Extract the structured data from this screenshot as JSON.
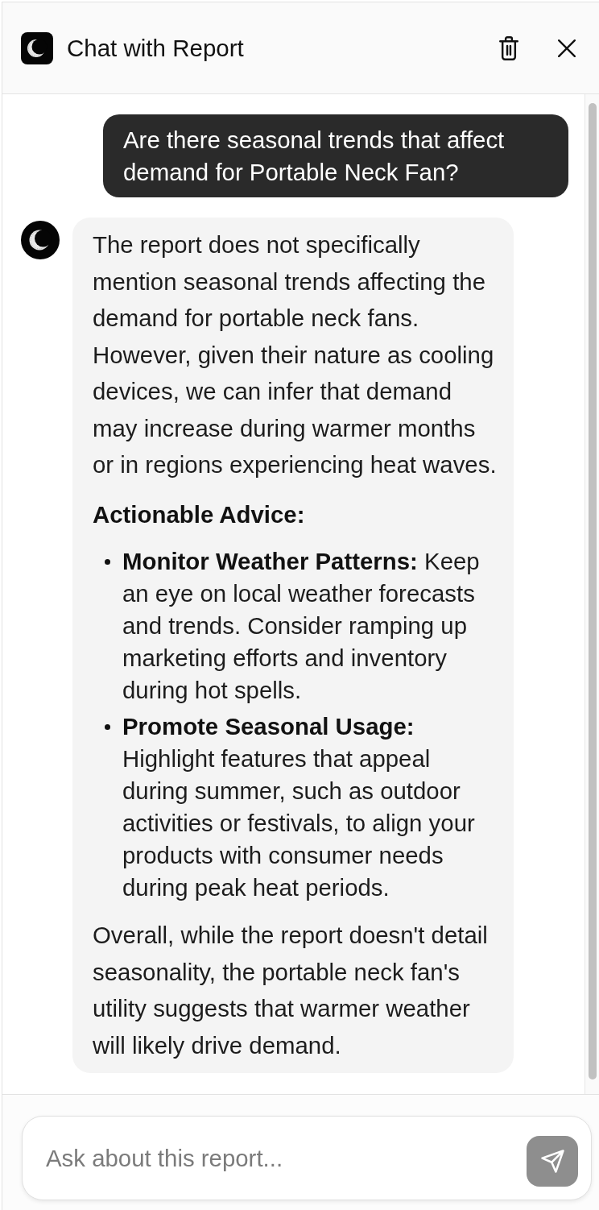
{
  "header": {
    "title": "Chat with Report"
  },
  "messages": [
    {
      "kind": "user",
      "text": "Are there seasonal trends that affect demand for Portable Neck Fan?"
    },
    {
      "kind": "assistant",
      "blocks": [
        {
          "kind": "paragraph",
          "text": "The report does not specifically mention seasonal trends affecting the demand for portable neck fans. However, given their nature as cooling devices, we can infer that demand may increase during warmer months or in regions experiencing heat waves."
        },
        {
          "kind": "heading",
          "text": "Actionable Advice:"
        },
        {
          "kind": "list",
          "items": [
            "**Monitor Weather Patterns:** Keep an eye on local weather forecasts and trends. Consider ramping up marketing efforts and inventory during hot spells.",
            "**Promote Seasonal Usage:** Highlight features that appeal during summer, such as outdoor activities or festivals, to align your products with consumer needs during peak heat periods."
          ]
        },
        {
          "kind": "paragraph",
          "text": "Overall, while the report doesn't detail seasonality, the portable neck fan's utility suggests that warmer weather will likely drive demand."
        }
      ]
    }
  ],
  "composer": {
    "placeholder": "Ask about this report..."
  }
}
